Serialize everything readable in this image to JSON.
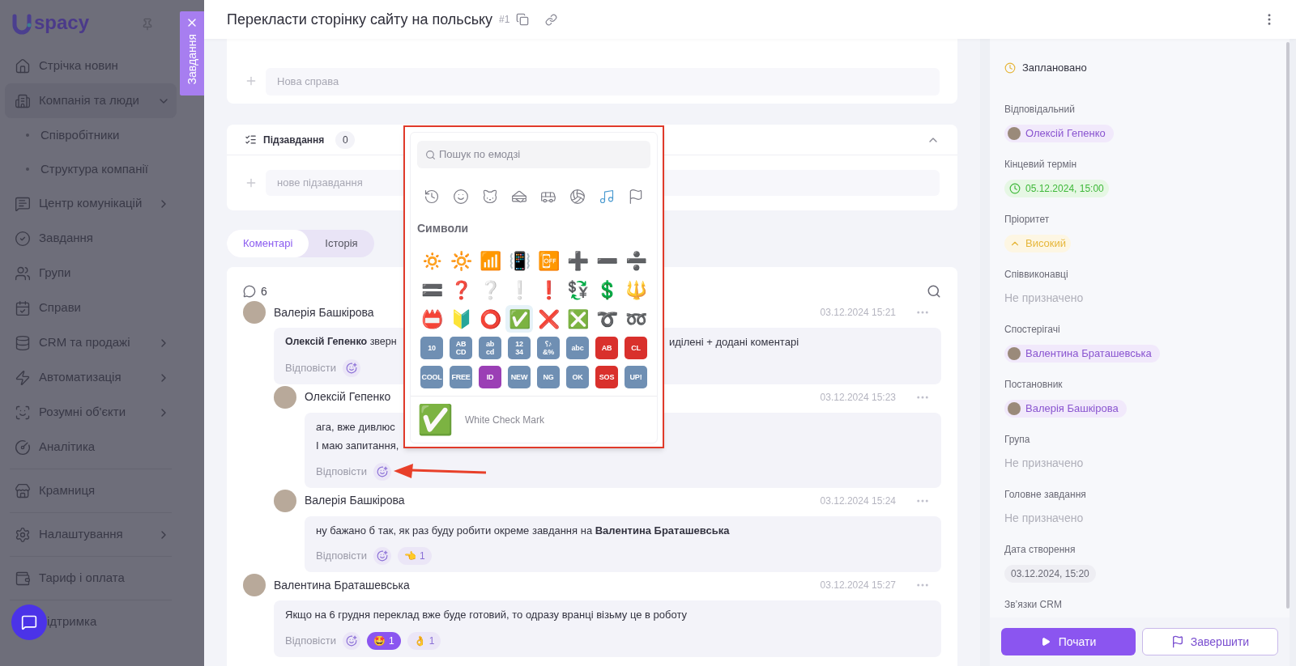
{
  "sidebar": {
    "logo": "spacy",
    "panel_tab": {
      "label": "Завдання"
    },
    "items": [
      {
        "label": "Стрічка новин"
      },
      {
        "label": "Компанія та люди",
        "expanded": true,
        "children": [
          {
            "label": "Співробітники"
          },
          {
            "label": "Структура компанії"
          }
        ]
      },
      {
        "label": "Центр комунікацій",
        "expanded": false
      },
      {
        "label": "Завдання"
      },
      {
        "label": "Групи"
      },
      {
        "label": "Справи"
      },
      {
        "label": "CRM та продажі",
        "expanded": false
      },
      {
        "label": "Автоматизація",
        "expanded": false
      },
      {
        "label": "Розумні об'єкти",
        "expanded": false
      },
      {
        "label": "Аналітика"
      },
      {
        "label": "Крамниця"
      },
      {
        "label": "Налаштування",
        "expanded": false
      },
      {
        "label": "Тариф і оплата"
      },
      {
        "label": "ідтримка"
      }
    ]
  },
  "task": {
    "title": "Перекласти сторінку сайту на польську",
    "number": "#1",
    "new_activity": {
      "placeholder": "Нова справа"
    },
    "subtasks": {
      "title": "Підзавдання",
      "count": "0",
      "expanded": true,
      "new_subtask": {
        "placeholder": "нове підзавдання"
      }
    },
    "tabs": [
      {
        "label": "Коментарі",
        "selected": true
      },
      {
        "label": "Історія",
        "selected": false
      }
    ],
    "comments": {
      "count": "6",
      "items": [
        {
          "author": "Валерія Башкірова",
          "time": "03.12.2024 15:21",
          "text": "**Олексій Гепенко** зверн",
          "text_after": "иділені + додані коментарі",
          "reply": "Відповісти",
          "replies": [
            {
              "author": "Олексій Гепенко",
              "time": "03.12.2024 15:23",
              "lines": [
                "ага, вже дивлюс",
                "І маю запитання,"
              ],
              "reply": "Відповісти"
            },
            {
              "author": "Валерія Башкірова",
              "time": "03.12.2024 15:24",
              "lines": [
                "ну бажано б так, як раз буду робити окреме завдання на **Валентина Браташевська**"
              ],
              "reply": "Відповісти",
              "reactions": [
                {
                  "emoji": "👈",
                  "count": "1",
                  "selected": false
                }
              ]
            }
          ]
        },
        {
          "author": "Валентина Браташевська",
          "time": "03.12.2024 15:27",
          "text": "Якщо на 6 грудня переклад вже буде готовий, то одразу вранці візьму це в роботу",
          "reply": "Відповісти",
          "reactions": [
            {
              "emoji": "🤩",
              "count": "1",
              "selected": true
            },
            {
              "emoji": "👌",
              "count": "1",
              "selected": false
            }
          ]
        }
      ]
    }
  },
  "emoji_picker": {
    "search": {
      "placeholder": "Пошук по емодзі"
    },
    "categories": [
      {
        "selected": false
      },
      {
        "selected": false
      },
      {
        "selected": false
      },
      {
        "selected": false
      },
      {
        "selected": false
      },
      {
        "selected": false
      },
      {
        "selected": true
      },
      {
        "selected": false
      }
    ],
    "section": "Символи",
    "rows": [
      [
        {
          "kind": "glyph",
          "char": "🔅",
          "selected": false
        },
        {
          "kind": "glyph",
          "char": "🔆",
          "selected": false
        },
        {
          "kind": "glyph",
          "char": "📶",
          "selected": false
        },
        {
          "kind": "glyph",
          "char": "📳",
          "selected": false
        },
        {
          "kind": "glyph",
          "char": "📴",
          "selected": false
        },
        {
          "kind": "glyph",
          "char": "➕",
          "selected": false
        },
        {
          "kind": "glyph",
          "char": "➖",
          "selected": false
        },
        {
          "kind": "glyph",
          "char": "➗",
          "selected": false
        }
      ],
      [
        {
          "kind": "glyph",
          "char": "🟰",
          "selected": false
        },
        {
          "kind": "glyph",
          "char": "❓",
          "selected": false
        },
        {
          "kind": "glyph",
          "char": "❔",
          "selected": false
        },
        {
          "kind": "glyph",
          "char": "❕",
          "selected": false
        },
        {
          "kind": "glyph",
          "char": "❗",
          "selected": false
        },
        {
          "kind": "glyph",
          "char": "💱",
          "selected": false
        },
        {
          "kind": "glyph",
          "char": "💲",
          "selected": false
        },
        {
          "kind": "glyph",
          "char": "🔱",
          "selected": false
        }
      ],
      [
        {
          "kind": "glyph",
          "char": "📛",
          "selected": false
        },
        {
          "kind": "glyph",
          "char": "🔰",
          "selected": false
        },
        {
          "kind": "glyph",
          "char": "⭕",
          "selected": false
        },
        {
          "kind": "glyph",
          "char": "✅",
          "selected": true
        },
        {
          "kind": "glyph",
          "char": "❌",
          "selected": false
        },
        {
          "kind": "glyph",
          "char": "❎",
          "selected": false
        },
        {
          "kind": "glyph",
          "char": "➰",
          "selected": false
        },
        {
          "kind": "glyph",
          "char": "➿",
          "selected": false
        }
      ],
      [
        {
          "kind": "tile",
          "label": "10",
          "color": "#6f8fb3",
          "selected": false
        },
        {
          "kind": "tile",
          "label": "AB CD",
          "color": "#6f8fb3",
          "selected": false
        },
        {
          "kind": "tile",
          "label": "ab cd",
          "color": "#6f8fb3",
          "selected": false
        },
        {
          "kind": "tile",
          "label": "12 34",
          "color": "#6f8fb3",
          "selected": false
        },
        {
          "kind": "tile",
          "label": "⸮♪ &%",
          "color": "#6f8fb3",
          "selected": false
        },
        {
          "kind": "tile",
          "label": "abc",
          "color": "#6f8fb3",
          "selected": false
        },
        {
          "kind": "tile",
          "label": "AB",
          "color": "#d9302c",
          "selected": false
        },
        {
          "kind": "tile",
          "label": "CL",
          "color": "#d9302c",
          "selected": false
        }
      ],
      [
        {
          "kind": "tile",
          "label": "COOL",
          "color": "#6f8fb3",
          "selected": false
        },
        {
          "kind": "tile",
          "label": "FREE",
          "color": "#6f8fb3",
          "selected": false
        },
        {
          "kind": "tile",
          "label": "ID",
          "color": "#9b3fb5",
          "selected": false
        },
        {
          "kind": "tile",
          "label": "NEW",
          "color": "#6f8fb3",
          "selected": false
        },
        {
          "kind": "tile",
          "label": "NG",
          "color": "#6f8fb3",
          "selected": false
        },
        {
          "kind": "tile",
          "label": "OK",
          "color": "#6f8fb3",
          "selected": false
        },
        {
          "kind": "tile",
          "label": "SOS",
          "color": "#d9302c",
          "selected": false
        },
        {
          "kind": "tile",
          "label": "UP!",
          "color": "#6f8fb3",
          "selected": false
        }
      ]
    ],
    "preview": {
      "char": "✅",
      "name": "White Check Mark"
    }
  },
  "details": {
    "status": "Заплановано",
    "fields": [
      {
        "label": "Відповідальний",
        "kind": "person",
        "value": "Олексій Гепенко"
      },
      {
        "label": "Кінцевий термін",
        "kind": "deadline",
        "value": "05.12.2024, 15:00"
      },
      {
        "label": "Пріоритет",
        "kind": "priority",
        "value": "Високий"
      },
      {
        "label": "Співвиконавці",
        "kind": "empty",
        "placeholder": "Не призначено"
      },
      {
        "label": "Спостерігачі",
        "kind": "person",
        "value": "Валентина Браташевська"
      },
      {
        "label": "Постановник",
        "kind": "person",
        "value": "Валерія Башкірова"
      },
      {
        "label": "Група",
        "kind": "empty",
        "placeholder": "Не призначено"
      },
      {
        "label": "Головне завдання",
        "kind": "empty",
        "placeholder": "Не призначено"
      },
      {
        "label": "Дата створення",
        "kind": "date",
        "value": "03.12.2024, 15:20"
      },
      {
        "label": "Зв’язки CRM",
        "kind": "label_only"
      }
    ],
    "buttons": [
      {
        "label": "Почати",
        "kind": "primary"
      },
      {
        "label": "Завершити",
        "kind": "secondary"
      }
    ]
  }
}
